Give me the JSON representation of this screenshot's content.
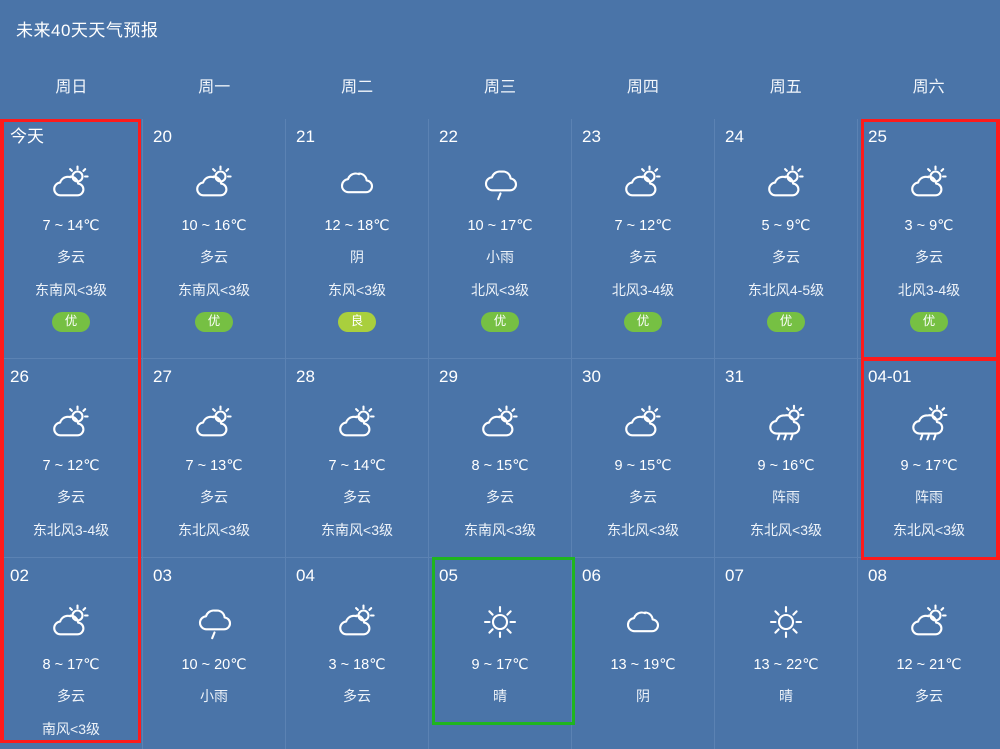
{
  "header": {
    "title": "未来40天天气预报"
  },
  "weekdays": [
    "周日",
    "周一",
    "周二",
    "周三",
    "周四",
    "周五",
    "周六"
  ],
  "colors": {
    "background": "#4a74a8",
    "cell_border": "#5b82b3",
    "aqi_good": "#76c043",
    "aqi_fair": "#a9cf3d",
    "highlight_red": "#fe1b1b",
    "highlight_green": "#1fb51f",
    "text": "#ffffff"
  },
  "rows": [
    {
      "cells": [
        {
          "day": "今天",
          "icon": "partly-cloudy-icon",
          "temps": "7 ~ 14℃",
          "condition": "多云",
          "wind": "东南风<3级",
          "aqi": "优",
          "aqi_level": "good"
        },
        {
          "day": "20",
          "icon": "partly-cloudy-icon",
          "temps": "10 ~ 16℃",
          "condition": "多云",
          "wind": "东南风<3级",
          "aqi": "优",
          "aqi_level": "good"
        },
        {
          "day": "21",
          "icon": "cloudy-icon",
          "temps": "12 ~ 18℃",
          "condition": "阴",
          "wind": "东风<3级",
          "aqi": "良",
          "aqi_level": "fair"
        },
        {
          "day": "22",
          "icon": "light-rain-icon",
          "temps": "10 ~ 17℃",
          "condition": "小雨",
          "wind": "北风<3级",
          "aqi": "优",
          "aqi_level": "good"
        },
        {
          "day": "23",
          "icon": "partly-cloudy-icon",
          "temps": "7 ~ 12℃",
          "condition": "多云",
          "wind": "北风3-4级",
          "aqi": "优",
          "aqi_level": "good"
        },
        {
          "day": "24",
          "icon": "partly-cloudy-icon",
          "temps": "5 ~ 9℃",
          "condition": "多云",
          "wind": "东北风4-5级",
          "aqi": "优",
          "aqi_level": "good"
        },
        {
          "day": "25",
          "icon": "partly-cloudy-icon",
          "temps": "3 ~ 9℃",
          "condition": "多云",
          "wind": "北风3-4级",
          "aqi": "优",
          "aqi_level": "good"
        }
      ]
    },
    {
      "cells": [
        {
          "day": "26",
          "icon": "partly-cloudy-icon",
          "temps": "7 ~ 12℃",
          "condition": "多云",
          "wind": "东北风3-4级",
          "aqi": "",
          "aqi_level": ""
        },
        {
          "day": "27",
          "icon": "partly-cloudy-icon",
          "temps": "7 ~ 13℃",
          "condition": "多云",
          "wind": "东北风<3级",
          "aqi": "",
          "aqi_level": ""
        },
        {
          "day": "28",
          "icon": "partly-cloudy-icon",
          "temps": "7 ~ 14℃",
          "condition": "多云",
          "wind": "东南风<3级",
          "aqi": "",
          "aqi_level": ""
        },
        {
          "day": "29",
          "icon": "partly-cloudy-icon",
          "temps": "8 ~ 15℃",
          "condition": "多云",
          "wind": "东南风<3级",
          "aqi": "",
          "aqi_level": ""
        },
        {
          "day": "30",
          "icon": "partly-cloudy-icon",
          "temps": "9 ~ 15℃",
          "condition": "多云",
          "wind": "东北风<3级",
          "aqi": "",
          "aqi_level": ""
        },
        {
          "day": "31",
          "icon": "shower-icon",
          "temps": "9 ~ 16℃",
          "condition": "阵雨",
          "wind": "东北风<3级",
          "aqi": "",
          "aqi_level": ""
        },
        {
          "day": "04-01",
          "icon": "shower-icon",
          "temps": "9 ~ 17℃",
          "condition": "阵雨",
          "wind": "东北风<3级",
          "aqi": "",
          "aqi_level": ""
        }
      ]
    },
    {
      "cells": [
        {
          "day": "02",
          "icon": "partly-cloudy-icon",
          "temps": "8 ~ 17℃",
          "condition": "多云",
          "wind": "南风<3级",
          "aqi": "",
          "aqi_level": ""
        },
        {
          "day": "03",
          "icon": "light-rain-icon",
          "temps": "10 ~ 20℃",
          "condition": "小雨",
          "wind": "",
          "aqi": "",
          "aqi_level": ""
        },
        {
          "day": "04",
          "icon": "partly-cloudy-icon",
          "temps": "3 ~ 18℃",
          "condition": "多云",
          "wind": "",
          "aqi": "",
          "aqi_level": ""
        },
        {
          "day": "05",
          "icon": "sunny-icon",
          "temps": "9 ~ 17℃",
          "condition": "晴",
          "wind": "",
          "aqi": "",
          "aqi_level": ""
        },
        {
          "day": "06",
          "icon": "cloudy-icon",
          "temps": "13 ~ 19℃",
          "condition": "阴",
          "wind": "",
          "aqi": "",
          "aqi_level": ""
        },
        {
          "day": "07",
          "icon": "sunny-icon",
          "temps": "13 ~ 22℃",
          "condition": "晴",
          "wind": "",
          "aqi": "",
          "aqi_level": ""
        },
        {
          "day": "08",
          "icon": "partly-cloudy-icon",
          "temps": "12 ~ 21℃",
          "condition": "多云",
          "wind": "",
          "aqi": "",
          "aqi_level": ""
        }
      ]
    }
  ],
  "highlights": [
    {
      "name": "sunday-column-highlight",
      "color": "red"
    },
    {
      "name": "saturday-column-highlight",
      "color": "red"
    },
    {
      "name": "sunny-day-highlight",
      "color": "green"
    }
  ]
}
